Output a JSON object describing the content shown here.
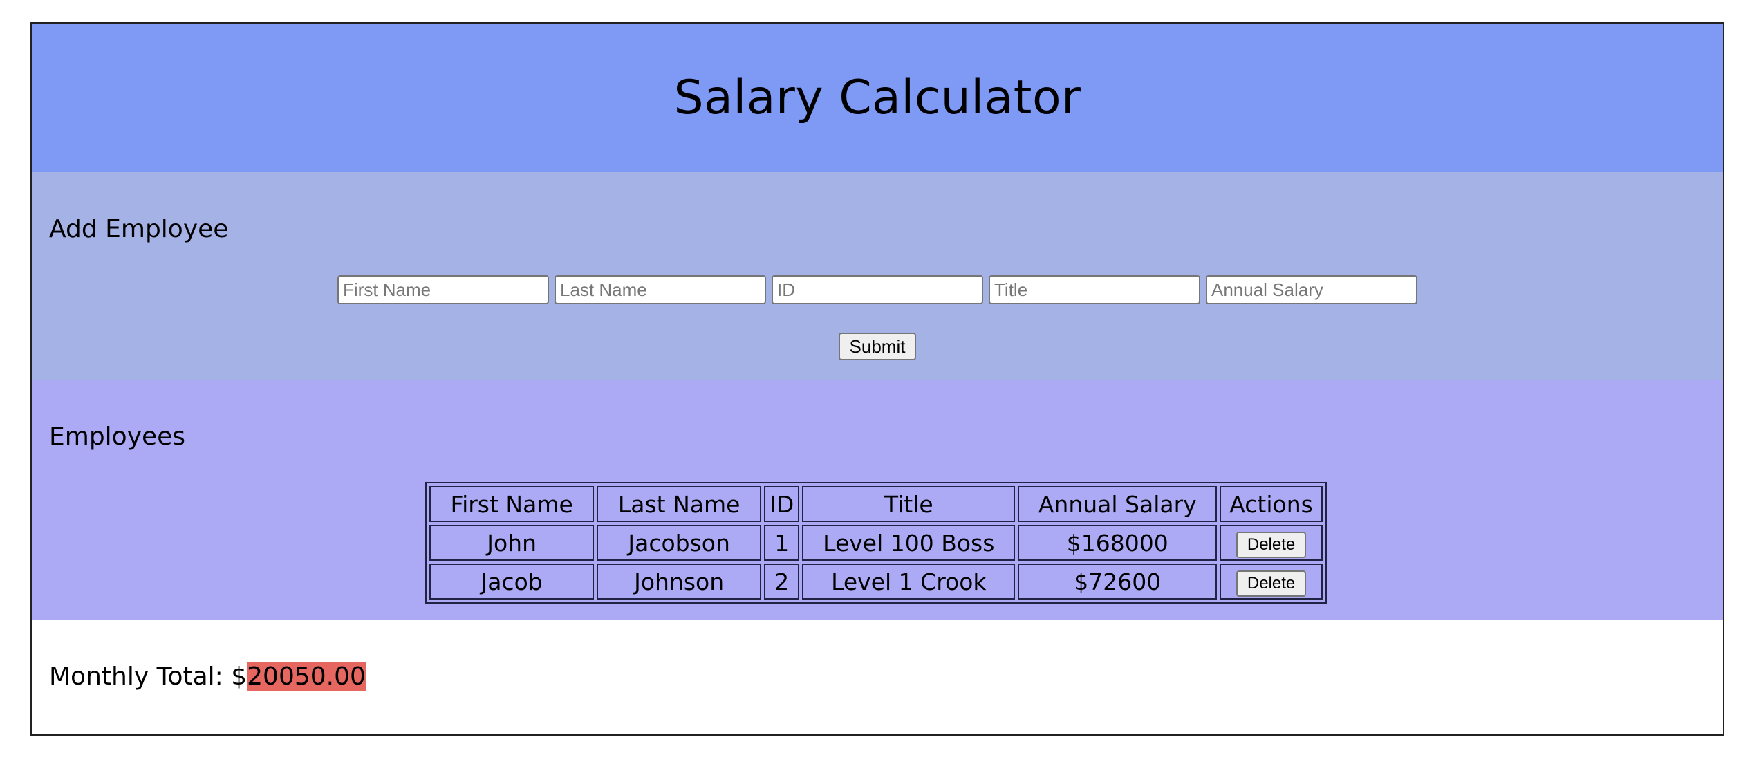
{
  "header": {
    "title": "Salary Calculator"
  },
  "add_employee": {
    "title": "Add Employee",
    "inputs": [
      {
        "placeholder": "First Name",
        "value": ""
      },
      {
        "placeholder": "Last Name",
        "value": ""
      },
      {
        "placeholder": "ID",
        "value": ""
      },
      {
        "placeholder": "Title",
        "value": ""
      },
      {
        "placeholder": "Annual Salary",
        "value": ""
      }
    ],
    "submit_label": "Submit"
  },
  "employees": {
    "title": "Employees",
    "columns": [
      "First Name",
      "Last Name",
      "ID",
      "Title",
      "Annual Salary",
      "Actions"
    ],
    "rows": [
      {
        "first_name": "John",
        "last_name": "Jacobson",
        "id": "1",
        "title": "Level 100 Boss",
        "salary": "$168000",
        "action_label": "Delete"
      },
      {
        "first_name": "Jacob",
        "last_name": "Johnson",
        "id": "2",
        "title": "Level 1 Crook",
        "salary": "$72600",
        "action_label": "Delete"
      }
    ]
  },
  "monthly_total": {
    "label": "Monthly Total: $",
    "value": "20050.00",
    "highlight_color": "#e5675f"
  },
  "colors": {
    "header_bg": "#7f9af5",
    "add_section_bg": "#a5b2e6",
    "employees_section_bg": "#adaaf5"
  }
}
